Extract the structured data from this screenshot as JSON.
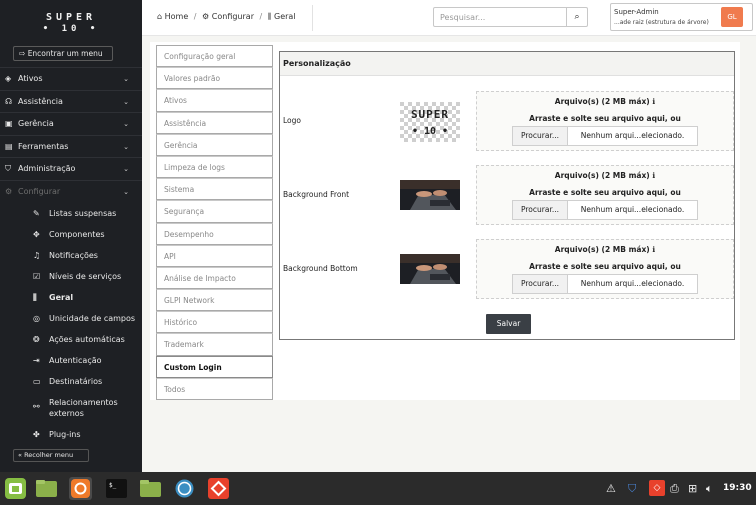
{
  "sidebar": {
    "logo_line1": "SUPER",
    "logo_line2": "• 10 •",
    "find_menu": "Encontrar um menu",
    "menu": [
      {
        "label": "Ativos"
      },
      {
        "label": "Assistência"
      },
      {
        "label": "Gerência"
      },
      {
        "label": "Ferramentas"
      },
      {
        "label": "Administração"
      },
      {
        "label": "Configurar"
      }
    ],
    "submenu": [
      {
        "label": "Listas suspensas"
      },
      {
        "label": "Componentes"
      },
      {
        "label": "Notificações"
      },
      {
        "label": "Níveis de serviços"
      },
      {
        "label": "Geral"
      },
      {
        "label": "Unicidade de campos"
      },
      {
        "label": "Ações automáticas"
      },
      {
        "label": "Autenticação"
      },
      {
        "label": "Destinatários"
      },
      {
        "label": "Relacionamentos externos"
      },
      {
        "label": "Plug-ins"
      }
    ],
    "collapse": "Recolher menu"
  },
  "header": {
    "breadcrumb": [
      "Home",
      "Configurar",
      "Geral"
    ],
    "search_placeholder": "Pesquisar...",
    "user_name": "Super-Admin",
    "user_entity": "...ade raiz (estrutura de árvore)",
    "avatar": "GL"
  },
  "tabs": [
    "Configuração geral",
    "Valores padrão",
    "Ativos",
    "Assistência",
    "Gerência",
    "Limpeza de logs",
    "Sistema",
    "Segurança",
    "Desempenho",
    "API",
    "Análise de Impacto",
    "GLPI Network",
    "Histórico",
    "Trademark",
    "Custom Login",
    "Todos"
  ],
  "active_tab": "Custom Login",
  "panel": {
    "title": "Personalização",
    "rows": [
      {
        "label": "Logo",
        "max": "Arquivo(s) (2 MB máx)",
        "drop": "Arraste e solte seu arquivo aqui, ou",
        "browse": "Procurar...",
        "file": "Nenhum arqui...elecionado."
      },
      {
        "label": "Background Front",
        "max": "Arquivo(s) (2 MB máx)",
        "drop": "Arraste e solte seu arquivo aqui, ou",
        "browse": "Procurar...",
        "file": "Nenhum arqui...elecionado."
      },
      {
        "label": "Background Bottom",
        "max": "Arquivo(s) (2 MB máx)",
        "drop": "Arraste e solte seu arquivo aqui, ou",
        "browse": "Procurar...",
        "file": "Nenhum arqui...elecionado."
      }
    ],
    "save": "Salvar",
    "logo_preview_line1": "SUPER",
    "logo_preview_line2": "• 10 •"
  },
  "taskbar": {
    "clock": "19:30",
    "apps": [
      "mint-menu-icon",
      "files-icon",
      "ubuntu-icon",
      "terminal-icon",
      "folder-icon",
      "network-icon",
      "anydesk-icon"
    ]
  },
  "colors": {
    "sidebar_bg": "#1e2024",
    "accent": "#f07b4e",
    "save_bg": "#3a3f45"
  }
}
